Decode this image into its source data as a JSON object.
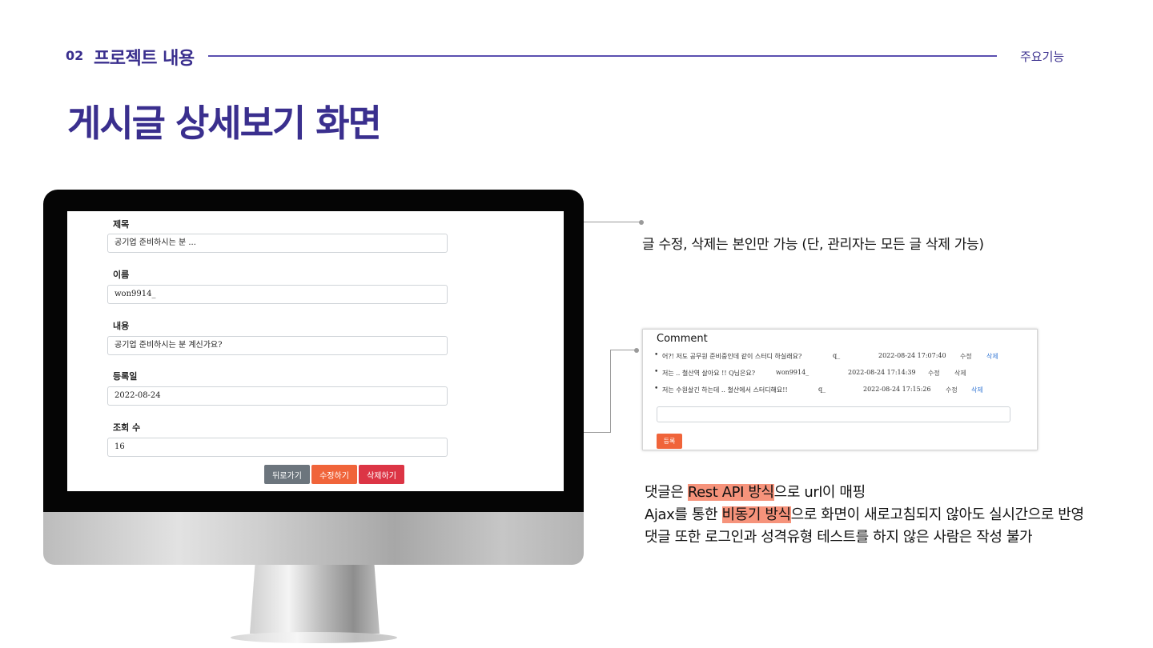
{
  "header": {
    "section_number": "02",
    "section_title": "프로젝트 내용",
    "right_label": "주요기능"
  },
  "page_title": "게시글 상세보기 화면",
  "screen": {
    "fields": [
      {
        "label": "제목",
        "value": "공기업 준비하시는 분 ..."
      },
      {
        "label": "이름",
        "value": "won9914_"
      },
      {
        "label": "내용",
        "value": "공기업 준비하시는 분 계신가요?"
      },
      {
        "label": "등록일",
        "value": "2022-08-24"
      },
      {
        "label": "조회 수",
        "value": "16"
      }
    ],
    "buttons": {
      "back": "뒤로가기",
      "edit": "수정하기",
      "delete": "삭제하기"
    }
  },
  "note_top": "글 수정, 삭제는 본인만 가능 (단, 관리자는 모든 글 삭제 가능)",
  "comments": {
    "title": "Comment",
    "items": [
      {
        "text": "어?! 저도 공무원 준비중인데 같이 스터디 하실래요?",
        "user": "q_",
        "date": "2022-08-24 17:07:40",
        "edit": "수정",
        "delete": "삭제"
      },
      {
        "text": "저는 .. 철산역 살아요 !! Q님은요?",
        "user": "won9914_",
        "date": "2022-08-24 17:14:39",
        "edit": "수정",
        "delete": "삭제"
      },
      {
        "text": "저는 수원살긴 하는데 .. 철산에서 스터디해요!!",
        "user": "q_",
        "date": "2022-08-24 17:15:26",
        "edit": "수정",
        "delete": "삭제"
      }
    ],
    "submit_label": "등록"
  },
  "notes": {
    "line1": {
      "pre": "댓글은 ",
      "highlight": "Rest API 방식",
      "post": "으로 url이 매핑"
    },
    "line2": {
      "pre": "Ajax를 통한 ",
      "highlight": "비동기 방식",
      "post": "으로 화면이 새로고침되지 않아도 실시간으로 반영"
    },
    "line3": "댓글 또한 로그인과 성격유형 테스트를 하지 않은 사람은 작성 불가"
  },
  "colors": {
    "brand": "#3a2f8e",
    "highlight": "#f6937b",
    "edit_button": "#f0643a",
    "delete_button": "#dc3545",
    "back_button": "#6c757d"
  }
}
